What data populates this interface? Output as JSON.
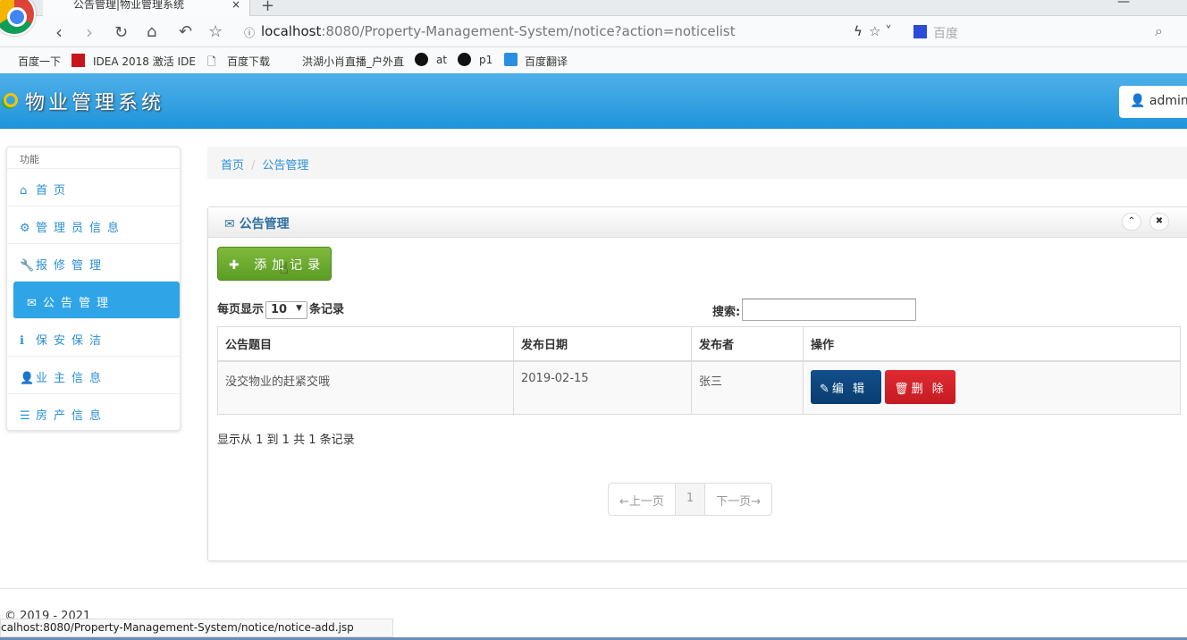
{
  "browser": {
    "tab_title": "公告管理|物业管理系统",
    "url_host": "localhost",
    "url_rest": ":8080/Property-Management-System/notice?action=noticelist",
    "search_engine": "百度",
    "bookmarks": [
      "百度一下",
      "IDEA 2018 激活 IDE",
      "百度下载",
      "洪湖小肖直播_户外直",
      "at",
      "p1",
      "百度翻译"
    ]
  },
  "header": {
    "brand": "物业管理系统",
    "user": "admin"
  },
  "sidebar": {
    "heading": "功能",
    "items": [
      {
        "label": "首页",
        "icon": "home-icon"
      },
      {
        "label": "管理员信息",
        "icon": "gear-icon"
      },
      {
        "label": "报修管理",
        "icon": "wrench-icon"
      },
      {
        "label": "公告管理",
        "icon": "envelope-icon",
        "active": true
      },
      {
        "label": "保安保洁",
        "icon": "info-icon"
      },
      {
        "label": "业主信息",
        "icon": "user-icon"
      },
      {
        "label": "房产信息",
        "icon": "list-icon"
      }
    ]
  },
  "breadcrumb": [
    "首页",
    "公告管理"
  ],
  "panel": {
    "title": "公告管理",
    "add_label": "添加记录",
    "per_page_prefix": "每页显示",
    "per_page_value": "10",
    "per_page_suffix": "条记录",
    "search_label": "搜索:",
    "columns": [
      "公告题目",
      "发布日期",
      "发布者",
      "操作"
    ],
    "rows": [
      {
        "title": "没交物业的赶紧交哦",
        "date": "2019-02-15",
        "author": "张三",
        "edit": "编 辑",
        "delete": "删 除"
      }
    ],
    "info": "显示从 1 到 1 共 1 条记录",
    "pagination": {
      "prev": "←上一页",
      "current": "1",
      "next": "下一页→"
    }
  },
  "footer": {
    "copyright": "© 2019 - 2021"
  },
  "status_bar": "calhost:8080/Property-Management-System/notice/notice-add.jsp",
  "colors": {
    "primary": "#2fa4e7",
    "success": "#6aab2f",
    "edit": "#0d4a86",
    "delete": "#d2232a"
  }
}
